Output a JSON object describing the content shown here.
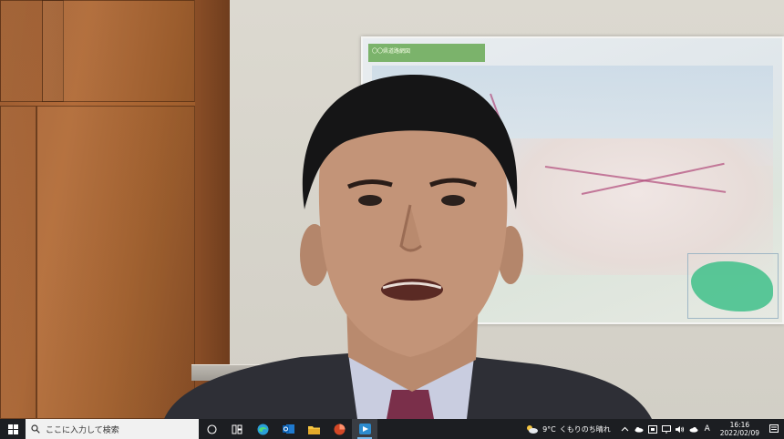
{
  "video": {
    "map_title": "〇〇県道路網図"
  },
  "taskbar": {
    "search_placeholder": "ここに入力して検索",
    "pinned_apps": [
      {
        "name": "task-view-icon"
      },
      {
        "name": "widgets-icon"
      },
      {
        "name": "edge-icon"
      },
      {
        "name": "outlook-icon"
      },
      {
        "name": "file-explorer-icon"
      },
      {
        "name": "powerpoint-icon"
      },
      {
        "name": "meeting-app-icon"
      }
    ],
    "weather": {
      "temperature": "9°C",
      "condition": "くもりのち晴れ"
    },
    "ime_indicator": "A",
    "clock": {
      "time": "16:16",
      "date": "2022/02/09"
    }
  },
  "colors": {
    "taskbar_bg": "#1c1e22",
    "accent": "#76b9ed"
  }
}
